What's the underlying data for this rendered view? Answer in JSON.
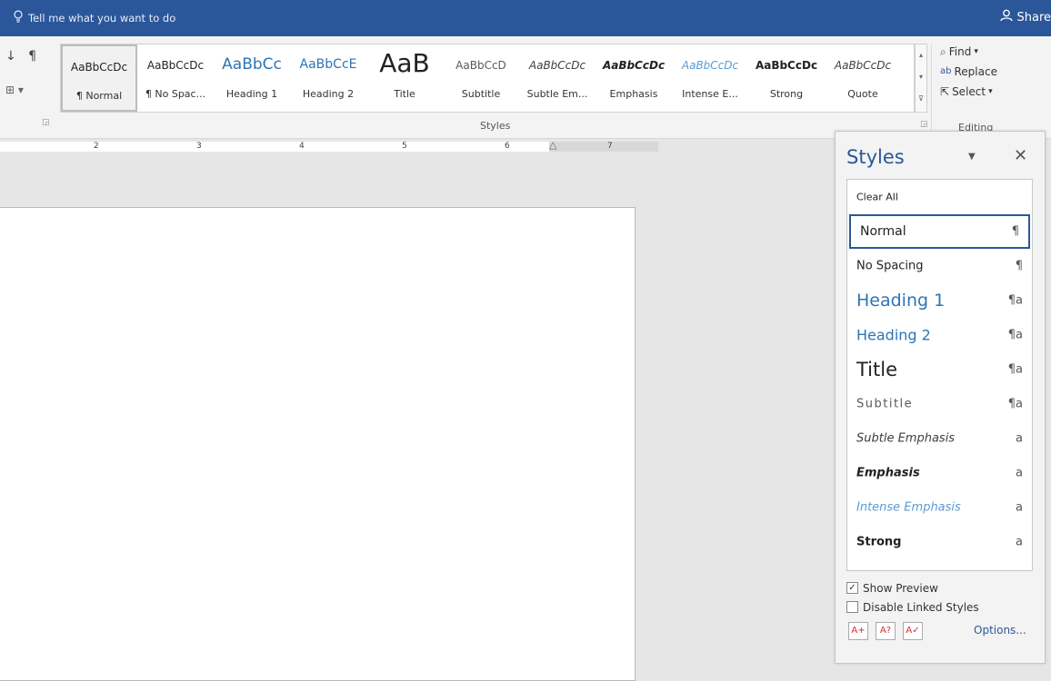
{
  "titlebar": {
    "tell_me": "Tell me what you want to do",
    "share": "Share"
  },
  "ribbon": {
    "gallery": [
      {
        "sample": "AaBbCcDc",
        "label": "¶ Normal",
        "color": "#222222",
        "size": "12px",
        "style": "normal",
        "weight": "normal"
      },
      {
        "sample": "AaBbCcDc",
        "label": "¶ No Spac...",
        "color": "#222222",
        "size": "12px",
        "style": "normal",
        "weight": "normal"
      },
      {
        "sample": "AaBbCc",
        "label": "Heading 1",
        "color": "#2e74b5",
        "size": "17px",
        "style": "normal",
        "weight": "normal"
      },
      {
        "sample": "AaBbCcE",
        "label": "Heading 2",
        "color": "#2e74b5",
        "size": "14px",
        "style": "normal",
        "weight": "normal"
      },
      {
        "sample": "AaB",
        "label": "Title",
        "color": "#222222",
        "size": "28px",
        "style": "normal",
        "weight": "normal"
      },
      {
        "sample": "AaBbCcD",
        "label": "Subtitle",
        "color": "#595959",
        "size": "12px",
        "style": "normal",
        "weight": "normal"
      },
      {
        "sample": "AaBbCcDc",
        "label": "Subtle Em...",
        "color": "#404040",
        "size": "12px",
        "style": "italic",
        "weight": "normal"
      },
      {
        "sample": "AaBbCcDc",
        "label": "Emphasis",
        "color": "#222222",
        "size": "12px",
        "style": "italic",
        "weight": "bold"
      },
      {
        "sample": "AaBbCcDc",
        "label": "Intense E...",
        "color": "#5b9bd5",
        "size": "12px",
        "style": "italic",
        "weight": "normal"
      },
      {
        "sample": "AaBbCcDc",
        "label": "Strong",
        "color": "#222222",
        "size": "12px",
        "style": "normal",
        "weight": "bold"
      },
      {
        "sample": "AaBbCcDc",
        "label": "Quote",
        "color": "#404040",
        "size": "12px",
        "style": "italic",
        "weight": "normal"
      }
    ],
    "styles_group": "Styles",
    "editing": {
      "find": "Find",
      "replace": "Replace",
      "select": "Select",
      "label": "Editing"
    },
    "ruler_numbers": [
      "2",
      "3",
      "4",
      "5",
      "6",
      "7"
    ]
  },
  "styles_pane": {
    "title": "Styles",
    "items": [
      {
        "name": "Clear All",
        "marker": "",
        "color": "#222222",
        "size": "11px",
        "style": "normal",
        "weight": "normal"
      },
      {
        "name": "Normal",
        "marker": "¶",
        "color": "#222222",
        "size": "14px",
        "style": "normal",
        "weight": "normal"
      },
      {
        "name": "No Spacing",
        "marker": "¶",
        "color": "#222222",
        "size": "13px",
        "style": "normal",
        "weight": "normal"
      },
      {
        "name": "Heading 1",
        "marker": "¶a",
        "color": "#2e74b5",
        "size": "19px",
        "style": "normal",
        "weight": "normal"
      },
      {
        "name": "Heading 2",
        "marker": "¶a",
        "color": "#2e74b5",
        "size": "16px",
        "style": "normal",
        "weight": "normal"
      },
      {
        "name": "Title",
        "marker": "¶a",
        "color": "#222222",
        "size": "21px",
        "style": "normal",
        "weight": "normal"
      },
      {
        "name": "Subtitle",
        "marker": "¶a",
        "color": "#595959",
        "size": "13px",
        "style": "normal",
        "weight": "normal"
      },
      {
        "name": "Subtle Emphasis",
        "marker": "a",
        "color": "#404040",
        "size": "13px",
        "style": "italic",
        "weight": "normal"
      },
      {
        "name": "Emphasis",
        "marker": "a",
        "color": "#222222",
        "size": "13px",
        "style": "italic",
        "weight": "bold"
      },
      {
        "name": "Intense Emphasis",
        "marker": "a",
        "color": "#5b9bd5",
        "size": "13px",
        "style": "italic",
        "weight": "normal"
      },
      {
        "name": "Strong",
        "marker": "a",
        "color": "#222222",
        "size": "13px",
        "style": "normal",
        "weight": "bold"
      }
    ],
    "selected": "Normal",
    "show_preview": "Show Preview",
    "disable_linked": "Disable Linked Styles",
    "options": "Options..."
  }
}
